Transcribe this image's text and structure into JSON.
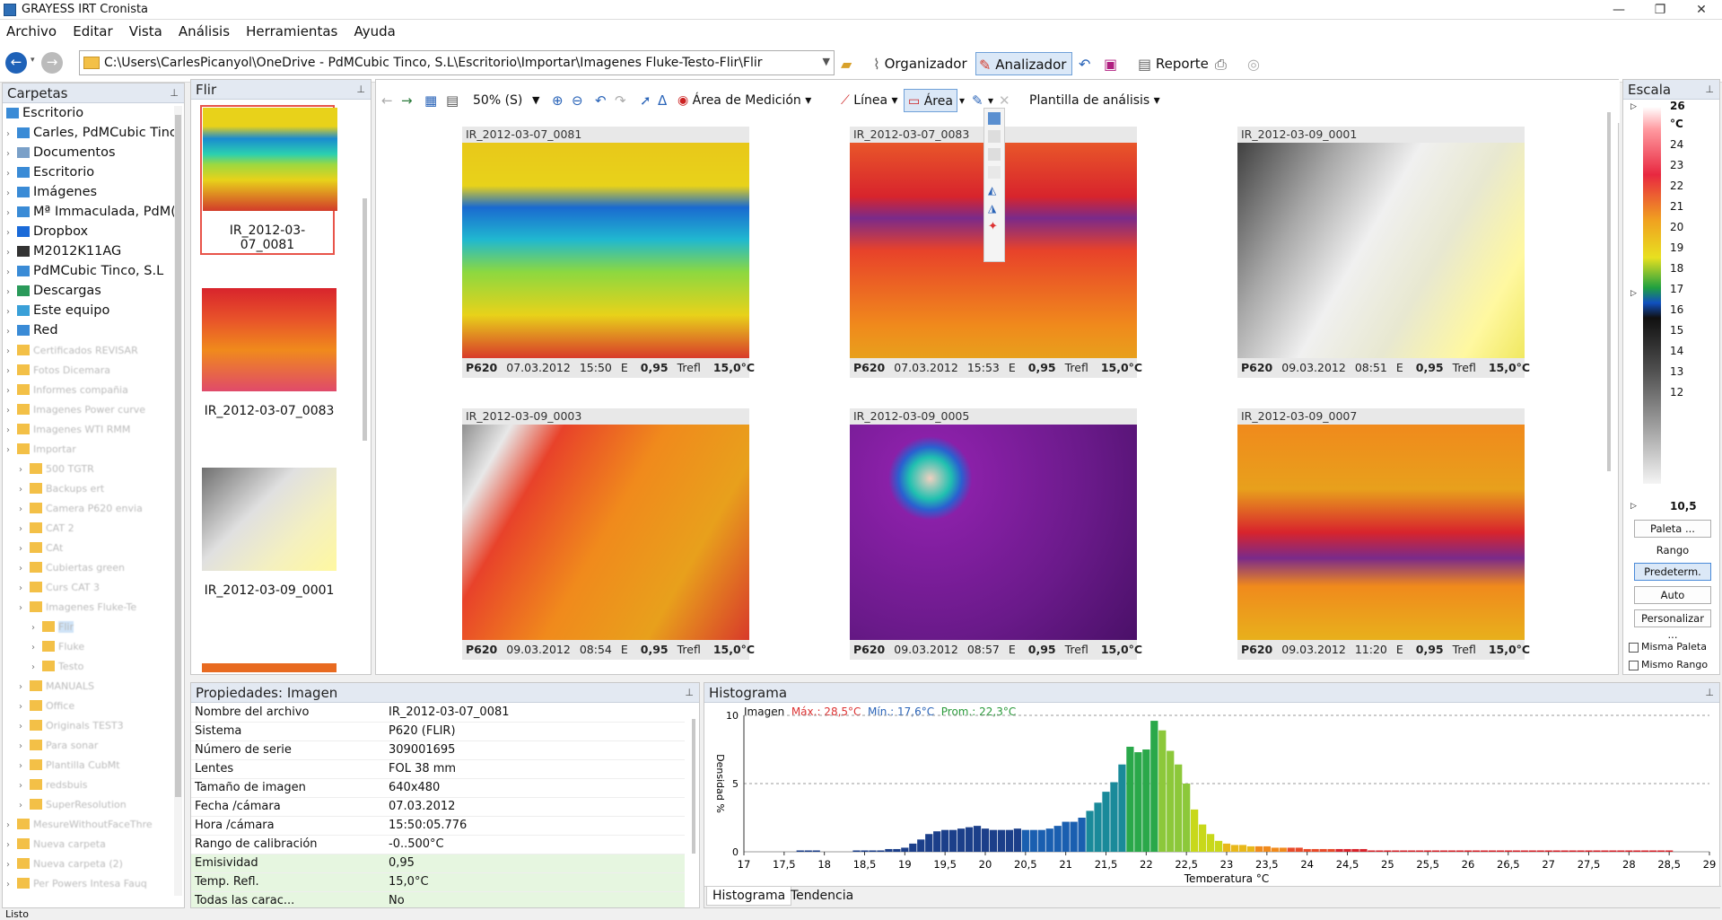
{
  "app": {
    "title": "GRAYESS IRT Cronista"
  },
  "window_buttons": [
    "—",
    "❐",
    "✕"
  ],
  "menu": [
    "Archivo",
    "Editar",
    "Vista",
    "Análisis",
    "Herramientas",
    "Ayuda"
  ],
  "toolbar": {
    "path": "C:\\Users\\CarlesPicanyol\\OneDrive - PdMCubic Tinco, S.L\\Escritorio\\Importar\\Imagenes Fluke-Testo-Flir\\Flir",
    "organizador": "Organizador",
    "analizador": "Analizador",
    "reporte": "Reporte"
  },
  "folders": {
    "title": "Carpetas",
    "root": "Escritorio",
    "items": [
      "Carles, PdMCubic Tinc",
      "Documentos",
      "Escritorio",
      "Imágenes",
      "Mª Immaculada, PdM(",
      "Dropbox",
      "M2012K11AG",
      "PdMCubic Tinco, S.L",
      "Descargas",
      "Este equipo",
      "Red"
    ],
    "blurred": [
      "Certificados REVISAR",
      "Fotos Dicemara",
      "Informes compañia",
      "Imagenes Power curve",
      "Imagenes WTI RMM",
      "Importar",
      "500 TGTR",
      "Backups ert",
      "Camera P620 envia",
      "CAT 2",
      "CAt",
      "Cubiertas green",
      "Curs CAT 3",
      "Imagenes Fluke-Te",
      "Flir",
      "Fluke",
      "Testo",
      "MANUALS",
      "Office",
      "Originals TEST3",
      "Para sonar",
      "Plantilla CubMt",
      "redsbuis",
      "SuperResolution",
      "MesureWithoutFaceThre",
      "Nueva carpeta",
      "Nueva carpeta (2)",
      "Per Powers Intesa Fauq"
    ]
  },
  "flir": {
    "title": "Flir",
    "thumbs": [
      "IR_2012-03-07_0081",
      "IR_2012-03-07_0083",
      "IR_2012-03-09_0001"
    ]
  },
  "viewer": {
    "zoom": "50% (S)",
    "area_medicion": "Área de Medición",
    "linea": "Línea",
    "area": "Área",
    "plantilla": "Plantilla de análisis",
    "cards": [
      {
        "name": "IR_2012-03-07_0081",
        "cam": "P620",
        "date": "07.03.2012",
        "time": "15:50",
        "e_label": "E",
        "e": "0,95",
        "t_label": "Trefl",
        "t": "15,0°C"
      },
      {
        "name": "IR_2012-03-07_0083",
        "cam": "P620",
        "date": "07.03.2012",
        "time": "15:53",
        "e_label": "E",
        "e": "0,95",
        "t_label": "Trefl",
        "t": "15,0°C"
      },
      {
        "name": "IR_2012-03-09_0001",
        "cam": "P620",
        "date": "09.03.2012",
        "time": "08:51",
        "e_label": "E",
        "e": "0,95",
        "t_label": "Trefl",
        "t": "15,0°C"
      },
      {
        "name": "IR_2012-03-09_0003",
        "cam": "P620",
        "date": "09.03.2012",
        "time": "08:54",
        "e_label": "E",
        "e": "0,95",
        "t_label": "Trefl",
        "t": "15,0°C"
      },
      {
        "name": "IR_2012-03-09_0005",
        "cam": "P620",
        "date": "09.03.2012",
        "time": "08:57",
        "e_label": "E",
        "e": "0,95",
        "t_label": "Trefl",
        "t": "15,0°C"
      },
      {
        "name": "IR_2012-03-09_0007",
        "cam": "P620",
        "date": "09.03.2012",
        "time": "11:20",
        "e_label": "E",
        "e": "0,95",
        "t_label": "Trefl",
        "t": "15,0°C"
      }
    ]
  },
  "scale": {
    "title": "Escala",
    "max": "26",
    "unit": "°C",
    "ticks": [
      "24",
      "23",
      "22",
      "21",
      "20",
      "19",
      "18",
      "17",
      "16",
      "15",
      "14",
      "13",
      "12"
    ],
    "min": "10,5",
    "paleta": "Paleta ...",
    "rango": "Rango",
    "predeterm": "Predeterm.",
    "auto": "Auto",
    "personalizar": "Personalizar ...",
    "misma_paleta": "Misma Paleta",
    "mismo_rango": "Mismo Rango"
  },
  "props": {
    "title": "Propiedades: Imagen",
    "rows": [
      {
        "k": "Nombre del archivo",
        "v": "IR_2012-03-07_0081"
      },
      {
        "k": "Sistema",
        "v": "P620 (FLIR)"
      },
      {
        "k": "Número de serie",
        "v": "309001695"
      },
      {
        "k": "Lentes",
        "v": "FOL 38 mm"
      },
      {
        "k": "Tamaño de imagen",
        "v": "640x480"
      },
      {
        "k": "Fecha /cámara",
        "v": "07.03.2012"
      },
      {
        "k": "Hora /cámara",
        "v": "15:50:05.776"
      },
      {
        "k": "Rango de calibración",
        "v": "-0..500°C"
      },
      {
        "k": "Emisividad",
        "v": "0,95"
      },
      {
        "k": "Temp. Refl.",
        "v": "15,0°C"
      },
      {
        "k": "Todas las carac...",
        "v": "No"
      }
    ]
  },
  "histogram": {
    "title": "Histograma",
    "legend_label": "Imagen",
    "max": "Máx.: 28,5°C",
    "min": "Mín.: 17,6°C",
    "avg": "Prom.: 22,3°C",
    "tabs": [
      "Histograma",
      "Tendencia"
    ]
  },
  "chart_data": {
    "type": "bar",
    "xlabel": "Temperatura °C",
    "ylabel": "Densidad %",
    "xlim": [
      17,
      29
    ],
    "ylim": [
      0,
      10
    ],
    "xticks": [
      "17",
      "17,5",
      "18",
      "18,5",
      "19",
      "19,5",
      "20",
      "20,5",
      "21",
      "21,5",
      "22",
      "22,5",
      "23",
      "23,5",
      "24",
      "24,5",
      "25",
      "25,5",
      "26",
      "26,5",
      "27",
      "27,5",
      "28",
      "28,5",
      "29"
    ],
    "yticks": [
      "0",
      "5",
      "10"
    ],
    "bins": [
      17.7,
      17.8,
      17.9,
      18.4,
      18.5,
      18.6,
      18.7,
      18.8,
      18.9,
      19.0,
      19.1,
      19.2,
      19.3,
      19.4,
      19.5,
      19.6,
      19.7,
      19.8,
      19.9,
      20.0,
      20.1,
      20.2,
      20.3,
      20.4,
      20.5,
      20.6,
      20.7,
      20.8,
      20.9,
      21.0,
      21.1,
      21.2,
      21.3,
      21.4,
      21.5,
      21.6,
      21.7,
      21.8,
      21.9,
      22.0,
      22.1,
      22.2,
      22.3,
      22.4,
      22.5,
      22.6,
      22.7,
      22.8,
      22.9,
      23.0,
      23.1,
      23.2,
      23.3,
      23.4,
      23.5,
      23.6,
      23.7,
      23.8,
      23.9,
      24.0,
      24.1,
      24.2,
      24.3,
      24.4,
      24.5,
      24.6,
      24.7,
      24.8,
      24.9,
      25.0,
      25.1,
      25.2,
      25.3,
      25.4,
      25.5,
      25.6,
      25.7,
      25.8,
      25.9,
      26.0,
      26.1,
      26.2,
      26.3,
      26.4,
      26.5,
      26.6,
      26.7,
      26.8,
      26.9,
      27.0,
      27.1,
      27.2,
      27.3,
      27.4,
      27.5,
      27.6,
      27.7,
      27.8,
      27.9,
      28.0,
      28.1,
      28.2,
      28.3,
      28.4,
      28.5
    ],
    "values": [
      0.1,
      0.1,
      0.1,
      0.1,
      0.1,
      0.1,
      0.1,
      0.2,
      0.2,
      0.3,
      0.6,
      0.9,
      1.3,
      1.5,
      1.6,
      1.6,
      1.7,
      1.8,
      1.9,
      1.7,
      1.6,
      1.6,
      1.6,
      1.7,
      1.6,
      1.6,
      1.6,
      1.7,
      1.9,
      2.2,
      2.2,
      2.5,
      3.0,
      3.6,
      4.4,
      5.1,
      6.4,
      7.7,
      7.3,
      7.5,
      9.6,
      8.9,
      7.4,
      6.4,
      5.0,
      3.1,
      2.0,
      1.3,
      0.8,
      0.6,
      0.5,
      0.5,
      0.4,
      0.4,
      0.4,
      0.3,
      0.3,
      0.3,
      0.3,
      0.2,
      0.2,
      0.2,
      0.2,
      0.2,
      0.2,
      0.2,
      0.2,
      0.1,
      0.1,
      0.1,
      0.1,
      0.1,
      0.1,
      0.1,
      0.1,
      0.1,
      0.1,
      0.1,
      0.1,
      0.1,
      0.1,
      0.1,
      0.1,
      0.1,
      0.1,
      0.1,
      0.1,
      0.1,
      0.1,
      0.1,
      0.1,
      0.1,
      0.1,
      0.1,
      0.1,
      0.1,
      0.1,
      0.1,
      0.1,
      0.1,
      0.1,
      0.1,
      0.1,
      0.1,
      0.1
    ]
  },
  "status": {
    "text": "Listo"
  }
}
